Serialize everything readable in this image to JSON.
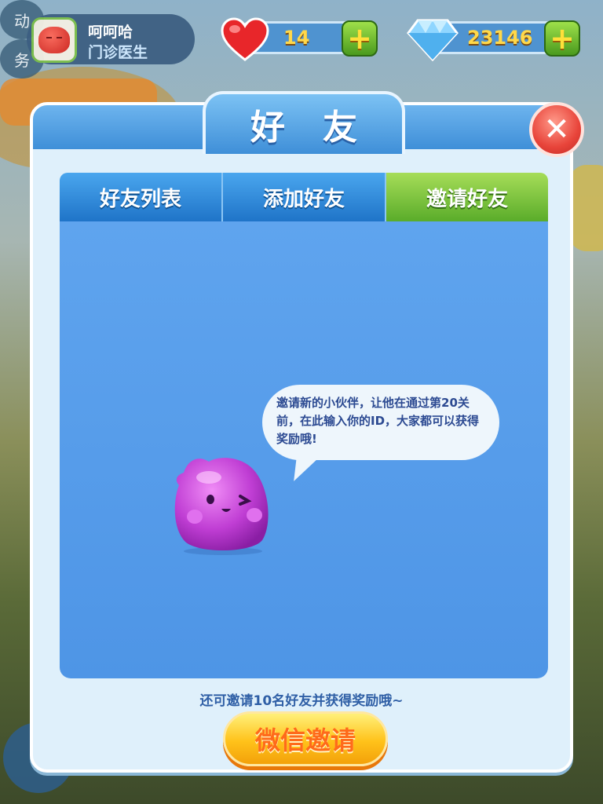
{
  "profile": {
    "name": "呵呵哈",
    "title": "门诊医生"
  },
  "resources": {
    "hearts": "14",
    "gems": "23146",
    "plus_symbol": "+"
  },
  "dialog": {
    "title": "好友",
    "close_symbol": "✕",
    "tabs": [
      {
        "label": "好友列表",
        "active": false
      },
      {
        "label": "添加好友",
        "active": false
      },
      {
        "label": "邀请好友",
        "active": true
      }
    ],
    "speech_text": "邀请新的小伙伴，让他在通过第20关前，在此输入你的ID，大家都可以获得奖励哦!",
    "invite_note": "还可邀请10名好友并获得奖励哦~",
    "wechat_button": "微信邀请"
  },
  "background": {
    "side_bubble_top": "动",
    "side_bubble_bottom": "务"
  },
  "icons": [
    "heart-icon",
    "gem-icon",
    "plus-icon",
    "close-icon",
    "mascot"
  ],
  "colors": {
    "accent_blue": "#4f93d0",
    "tab_active_green": "#5aac2a",
    "button_yellow": "#ffc21a",
    "close_red": "#e8443a"
  }
}
